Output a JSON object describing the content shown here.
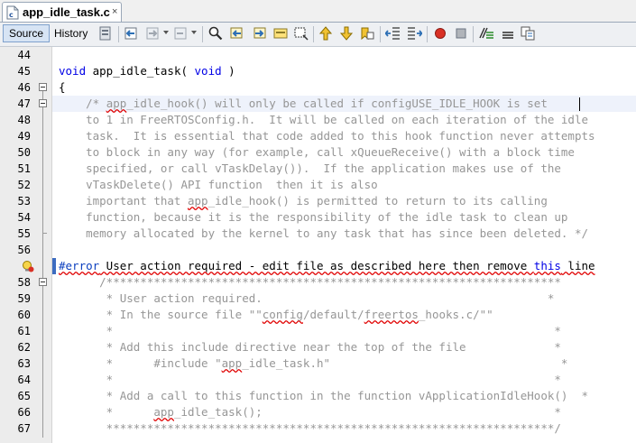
{
  "tab": {
    "filename": "app_idle_task.c",
    "close": "×"
  },
  "toolbar": {
    "source_label": "Source",
    "history_label": "History",
    "icons": [
      "last-edit-icon",
      "back-icon",
      "forward-icon",
      "find-selection-icon",
      "find-previous-icon",
      "find-next-icon",
      "toggle-highlight-icon",
      "toggle-rect-select-icon",
      "previous-bookmark-icon",
      "next-bookmark-icon",
      "toggle-bookmark-icon",
      "shift-left-icon",
      "shift-right-icon",
      "start-macro-icon",
      "stop-macro-icon",
      "comment-icon",
      "uncomment-icon",
      "diff-icon"
    ]
  },
  "editor": {
    "lines": [
      {
        "num": "44",
        "text": ""
      },
      {
        "num": "45",
        "text": "void app_idle_task( void )"
      },
      {
        "num": "46",
        "text": "{"
      },
      {
        "num": "47",
        "text": "    /* app_idle_hook() will only be called if configUSE_IDLE_HOOK is set"
      },
      {
        "num": "48",
        "text": "    to 1 in FreeRTOSConfig.h.  It will be called on each iteration of the idle"
      },
      {
        "num": "49",
        "text": "    task.  It is essential that code added to this hook function never attempts"
      },
      {
        "num": "50",
        "text": "    to block in any way (for example, call xQueueReceive() with a block time"
      },
      {
        "num": "51",
        "text": "    specified, or call vTaskDelay()).  If the application makes use of the"
      },
      {
        "num": "52",
        "text": "    vTaskDelete() API function  then it is also"
      },
      {
        "num": "53",
        "text": "    important that app_idle_hook() is permitted to return to its calling"
      },
      {
        "num": "54",
        "text": "    function, because it is the responsibility of the idle task to clean up"
      },
      {
        "num": "55",
        "text": "    memory allocated by the kernel to any task that has since been deleted. */"
      },
      {
        "num": "56",
        "text": ""
      },
      {
        "num": "",
        "text": "#error User action required - edit file as described here then remove this line"
      },
      {
        "num": "58",
        "text": "      /*******************************************************************"
      },
      {
        "num": "59",
        "text": "       * User action required.                                          *"
      },
      {
        "num": "60",
        "text": "       * In the source file \"\"config/default/freertos_hooks.c/\"\""
      },
      {
        "num": "61",
        "text": "       *                                                                 *"
      },
      {
        "num": "62",
        "text": "       * Add this include directive near the top of the file             *"
      },
      {
        "num": "63",
        "text": "       *      #include \"app_idle_task.h\"                                  *"
      },
      {
        "num": "64",
        "text": "       *                                                                 *"
      },
      {
        "num": "65",
        "text": "       * Add a call to this function in the function vApplicationIdleHook()  *"
      },
      {
        "num": "66",
        "text": "       *      app_idle_task();                                           *"
      },
      {
        "num": "67",
        "text": "       ******************************************************************/"
      }
    ]
  },
  "colors": {
    "keyword": "#0000e6",
    "comment": "#969696",
    "squiggle": "#e00000",
    "current_line": "#eef2fb"
  }
}
